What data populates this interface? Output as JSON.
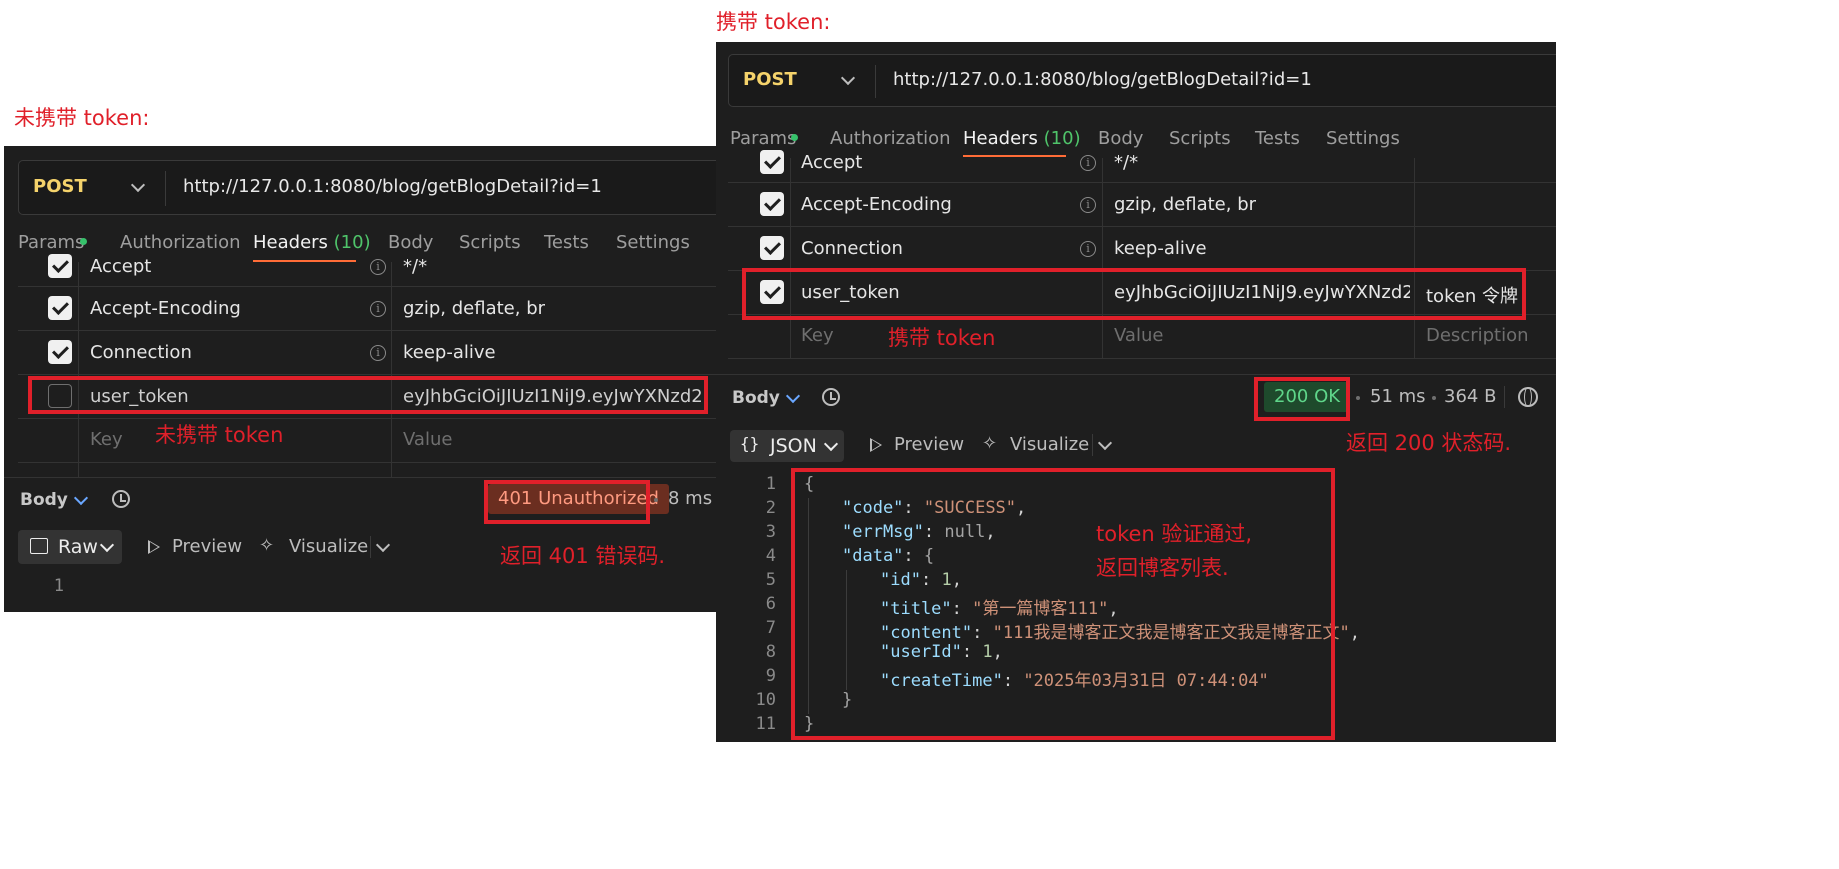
{
  "left": {
    "caption": "未携带 token:",
    "method": "POST",
    "url": "http://127.0.0.1:8080/blog/getBlogDetail?id=1",
    "tabs": [
      {
        "label": "Params"
      },
      {
        "label": "Authorization"
      },
      {
        "label": "Headers",
        "count": "(10)"
      },
      {
        "label": "Body"
      },
      {
        "label": "Scripts"
      },
      {
        "label": "Tests"
      },
      {
        "label": "Settings"
      }
    ],
    "rows": [
      {
        "key": "Accept",
        "value": "*/*",
        "checked": true
      },
      {
        "key": "Accept-Encoding",
        "value": "gzip, deflate, br",
        "checked": true
      },
      {
        "key": "Connection",
        "value": "keep-alive",
        "checked": true
      },
      {
        "key": "user_token",
        "value": "eyJhbGciOiJIUzI1NiJ9.eyJwYXNzd29...",
        "checked": false
      }
    ],
    "placeholder": {
      "key": "Key",
      "value": "Value"
    },
    "annotation_row": "未携带 token",
    "response": {
      "label": "Body",
      "status": "401 Unauthorized",
      "time": "8 ms",
      "format": "Raw",
      "preview": "Preview",
      "visualize": "Visualize",
      "line_numbers": [
        "1"
      ]
    },
    "annotation_status": "返回 401 错误码."
  },
  "right": {
    "caption": "携带 token:",
    "method": "POST",
    "url": "http://127.0.0.1:8080/blog/getBlogDetail?id=1",
    "tabs": [
      {
        "label": "Params"
      },
      {
        "label": "Authorization"
      },
      {
        "label": "Headers",
        "count": "(10)"
      },
      {
        "label": "Body"
      },
      {
        "label": "Scripts"
      },
      {
        "label": "Tests"
      },
      {
        "label": "Settings"
      }
    ],
    "rows": [
      {
        "key": "Accept",
        "value": "*/*",
        "checked": true
      },
      {
        "key": "Accept-Encoding",
        "value": "gzip, deflate, br",
        "checked": true
      },
      {
        "key": "Connection",
        "value": "keep-alive",
        "checked": true
      },
      {
        "key": "user_token",
        "value": "eyJhbGciOiJIUzI1NiJ9.eyJwYXNzd29...",
        "description": "token 令牌",
        "checked": true
      }
    ],
    "placeholder": {
      "key": "Key",
      "value": "Value",
      "description": "Description"
    },
    "annotation_row": "携带 token",
    "response": {
      "label": "Body",
      "status": "200 OK",
      "time": "51 ms",
      "size": "364 B",
      "format": "JSON",
      "preview": "Preview",
      "visualize": "Visualize",
      "line_numbers": [
        "1",
        "2",
        "3",
        "4",
        "5",
        "6",
        "7",
        "8",
        "9",
        "10",
        "11"
      ],
      "json": {
        "code": "\"SUCCESS\"",
        "errMsg": "null",
        "id": "1",
        "title": "\"第一篇博客111\"",
        "content": "\"111我是博客正文我是博客正文我是博客正文\"",
        "userId": "1",
        "createTime": "\"2025年03月31日 07:44:04\""
      }
    },
    "annotation_status": "返回 200 状态码.",
    "annotation_body_1": "token 验证通过,",
    "annotation_body_2": "返回博客列表."
  },
  "colors": {
    "annotation": "#e0202a",
    "panel_bg": "#1e1e1e",
    "method": "#f5d36b",
    "tab_active_underline": "#ff6c37",
    "ok_green": "#4fc46a",
    "error_bg": "#6b2e20"
  },
  "icons": [
    "chevron-down-icon",
    "info-icon",
    "checkbox-checked-icon",
    "checkbox-unchecked-icon",
    "history-icon",
    "play-icon",
    "sparkle-icon",
    "globe-icon",
    "braces-icon",
    "raw-doc-icon"
  ]
}
